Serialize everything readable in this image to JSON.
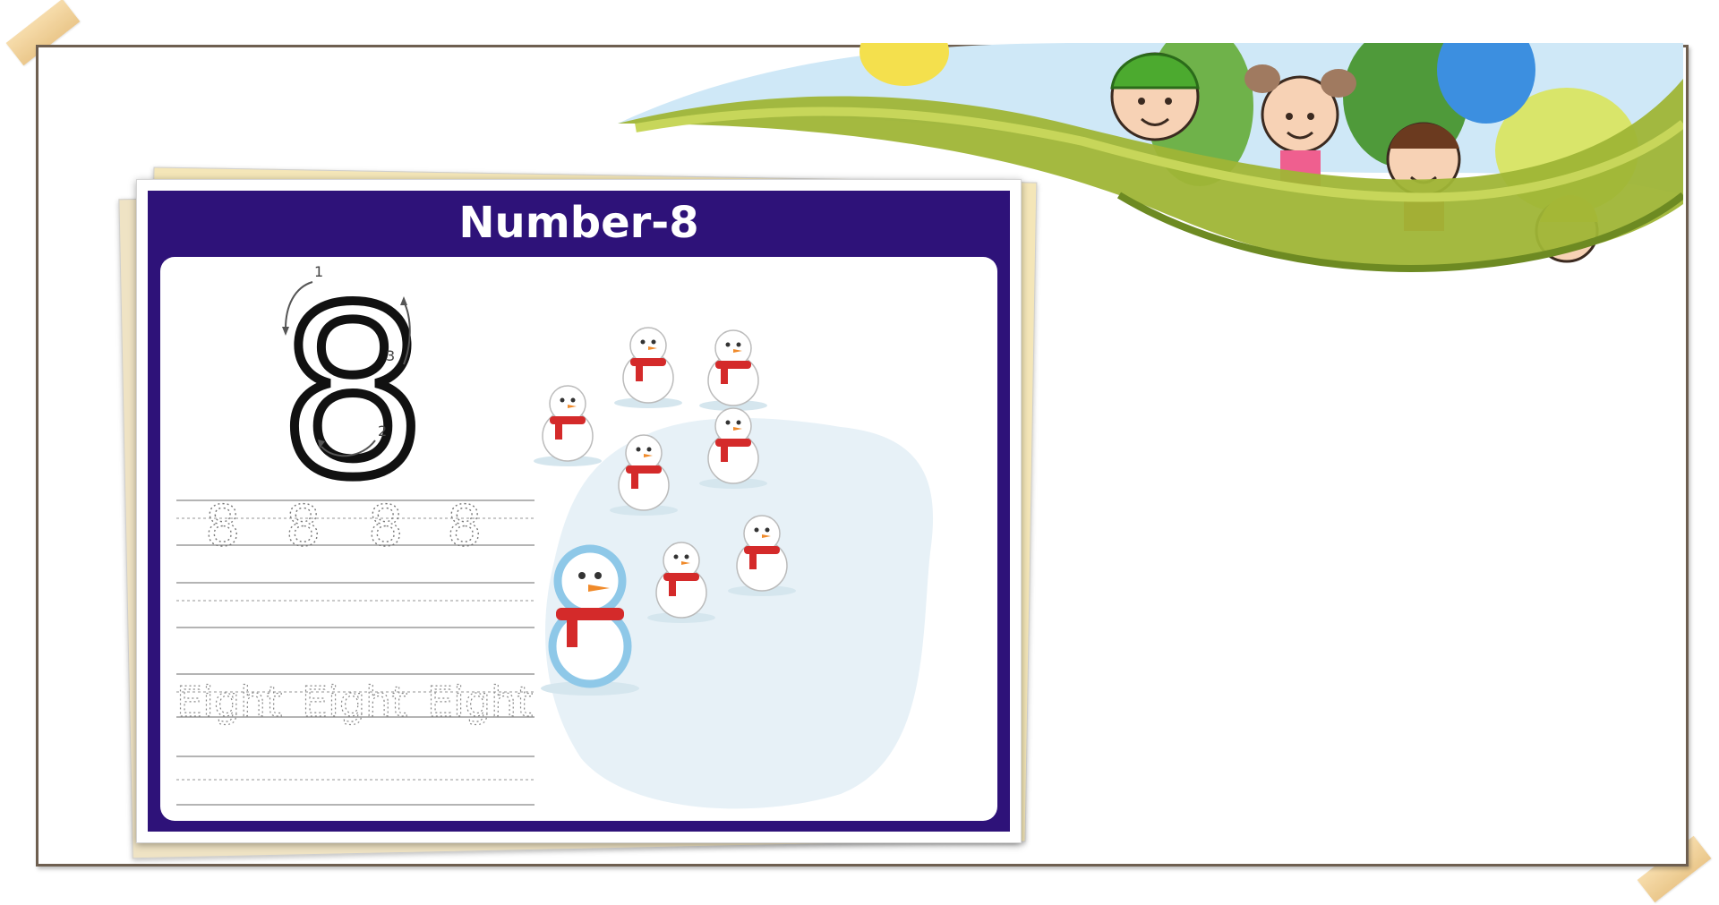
{
  "worksheet": {
    "title": "Number-8",
    "digit": "8",
    "stroke_steps": [
      "1",
      "2",
      "3"
    ],
    "trace_digits": [
      "8",
      "8",
      "8",
      "8"
    ],
    "trace_words": [
      "Eight",
      "Eight",
      "Eight"
    ],
    "snowman_count": 8
  },
  "colors": {
    "title_bar": "#2e1279",
    "scarf": "#d42a2a",
    "highlight_snowman": "#8ec8e8",
    "tape": "#f0cf90"
  }
}
